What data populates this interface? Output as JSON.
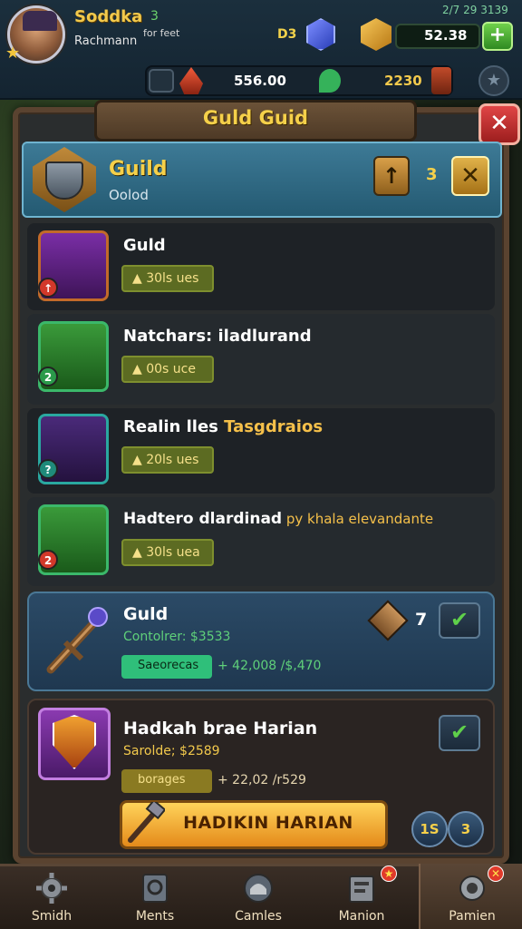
{
  "player": {
    "name": "Soddka",
    "level_text": "3",
    "subtitle": "Rachmann",
    "tag": "for feet"
  },
  "status": {
    "clock": "2/7 29 3139"
  },
  "currency": {
    "gems": "D3",
    "gold": "52.38",
    "res1": "556.00",
    "res2": "2230"
  },
  "panel": {
    "title": "Guld Guid"
  },
  "guild": {
    "name": "Guild",
    "subtitle": "Oolod",
    "count": "3"
  },
  "items": [
    {
      "title": "Guld",
      "cost": "30ls ues",
      "frame_color": "#c26a2a",
      "badge_color": "#d2382a",
      "badge": "↑"
    },
    {
      "title": "Natchars: iladlurand",
      "cost": "00s uce",
      "frame_color": "#3bb86a",
      "badge_color": "#2a9a4a",
      "badge": "2"
    },
    {
      "title_a": "Realin lles ",
      "title_b": "Tasgdraios",
      "cost": "20ls ues",
      "frame_color": "#2aa8a0",
      "badge_color": "#1f8a7a",
      "badge": "?"
    },
    {
      "title_a": "Hadtero dlardinad",
      "title_b": " py khala elevandante",
      "cost": "30ls uea",
      "frame_color": "#3bb86a",
      "badge_color": "#d2382a",
      "badge": "2"
    }
  ],
  "featured": {
    "title": "Guld",
    "line": "Contolrer: $3533",
    "pill": "Saeorecas",
    "progress": "+ 42,008 /$,470",
    "num": "7"
  },
  "featured2": {
    "title": "Hadkah brae Harian",
    "line": "Sarolde; $2589",
    "pill": "borages",
    "progress": "+ 22,02 /r529",
    "cta": "HADIKIN HARIAN",
    "round1": "1S",
    "round2": "3"
  },
  "nav": [
    {
      "label": "Smidh",
      "icon": "gear-icon"
    },
    {
      "label": "Ments",
      "icon": "map-icon"
    },
    {
      "label": "Camles",
      "icon": "helmet-icon"
    },
    {
      "label": "Manion",
      "icon": "scroll-icon"
    },
    {
      "label": "Pamien",
      "icon": "cog-icon"
    }
  ]
}
